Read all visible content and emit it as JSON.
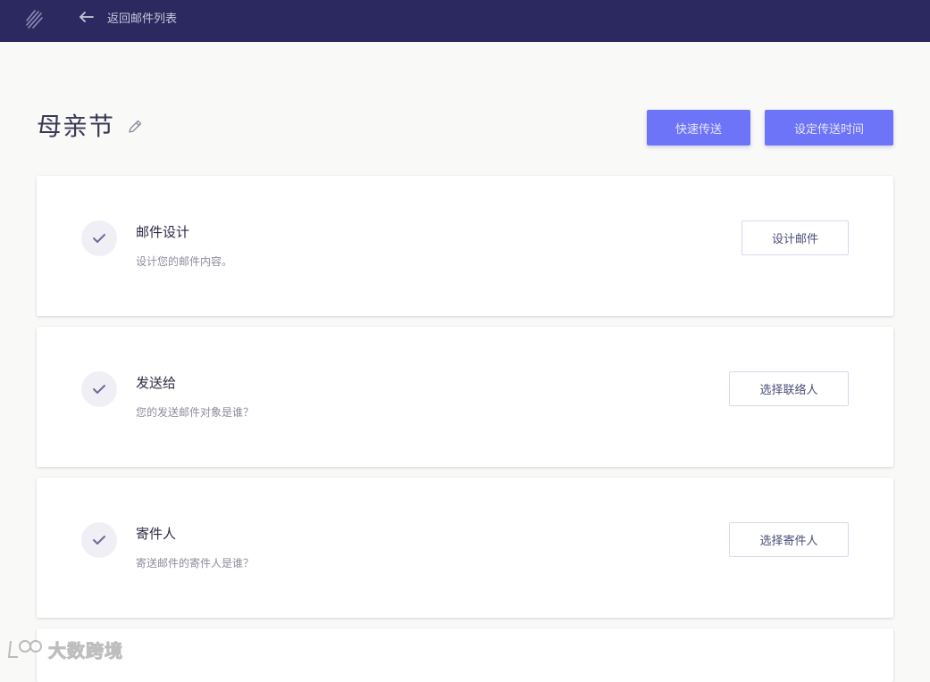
{
  "header": {
    "logo_icon": "slash-lines-logo-icon",
    "back_label": "返回邮件列表",
    "back_icon": "arrow-left-icon",
    "background": "#2c2860"
  },
  "campaign": {
    "title": "母亲节",
    "edit_icon": "pencil-icon",
    "quick_send_label": "快速传送",
    "schedule_label": "设定传送时间",
    "accent": "#6e74f7"
  },
  "steps": [
    {
      "title": "邮件设计",
      "description": "设计您的邮件内容。",
      "button_label": "设计邮件",
      "icon": "check-icon"
    },
    {
      "title": "发送给",
      "description": "您的发送邮件对象是谁？",
      "button_label": "选择联络人",
      "icon": "check-icon"
    },
    {
      "title": "寄件人",
      "description": "寄送邮件的寄件人是谁？",
      "button_label": "选择寄件人",
      "icon": "check-icon"
    }
  ],
  "watermark": {
    "text": "大数跨境"
  }
}
